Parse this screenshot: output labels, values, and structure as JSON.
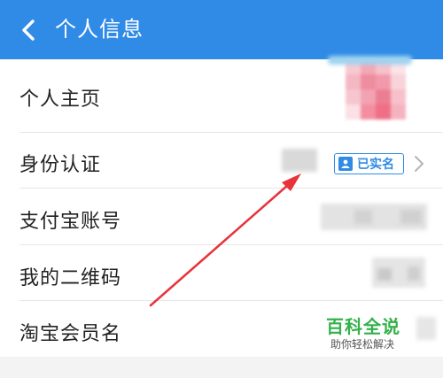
{
  "header": {
    "title": "个人信息",
    "background_color": "#2f8be6"
  },
  "rows": [
    {
      "label": "个人主页"
    },
    {
      "label": "身份认证",
      "badge": "已实名"
    },
    {
      "label": "支付宝账号"
    },
    {
      "label": "我的二维码"
    },
    {
      "label": "淘宝会员名"
    }
  ],
  "icons": {
    "back": "chevron-left-icon",
    "verified": "person-badge-icon",
    "more": "chevron-right-icon"
  },
  "annotation": {
    "color": "#e8333b"
  },
  "watermark": {
    "main": "百科全说",
    "sub": "助你轻松解决"
  }
}
